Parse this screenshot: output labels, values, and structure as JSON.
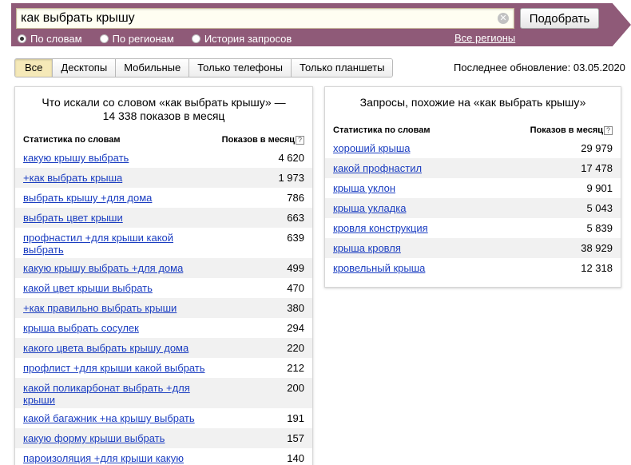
{
  "search": {
    "query": "как выбрать крышу",
    "button_label": "Подобрать",
    "clear_icon": "✕"
  },
  "modes": [
    {
      "label": "По словам",
      "checked": true
    },
    {
      "label": "По регионам",
      "checked": false
    },
    {
      "label": "История запросов",
      "checked": false
    }
  ],
  "regions_link": "Все регионы",
  "tabs": [
    {
      "label": "Все",
      "active": true
    },
    {
      "label": "Десктопы",
      "active": false
    },
    {
      "label": "Мобильные",
      "active": false
    },
    {
      "label": "Только телефоны",
      "active": false
    },
    {
      "label": "Только планшеты",
      "active": false
    }
  ],
  "last_update": "Последнее обновление: 03.05.2020",
  "left_panel": {
    "title": "Что искали со словом «как выбрать крышу» — 14 338 показов в месяц",
    "col_stat": "Статистика по словам",
    "col_shows": "Показов в месяц",
    "help_icon": "?",
    "rows": [
      {
        "phrase": "какую крышу выбрать",
        "count": "4 620"
      },
      {
        "phrase": "+как выбрать крыша",
        "count": "1 973"
      },
      {
        "phrase": "выбрать крышу +для дома",
        "count": "786"
      },
      {
        "phrase": "выбрать цвет крыши",
        "count": "663"
      },
      {
        "phrase": "профнастил +для крыши какой выбрать",
        "count": "639"
      },
      {
        "phrase": "какую крышу выбрать +для дома",
        "count": "499"
      },
      {
        "phrase": "какой цвет крыши выбрать",
        "count": "470"
      },
      {
        "phrase": "+как правильно выбрать крыши",
        "count": "380"
      },
      {
        "phrase": "крыша выбрать сосулек",
        "count": "294"
      },
      {
        "phrase": "какого цвета выбрать крышу дома",
        "count": "220"
      },
      {
        "phrase": "профлист +для крыши какой выбрать",
        "count": "212"
      },
      {
        "phrase": "какой поликарбонат выбрать +для крыши",
        "count": "200"
      },
      {
        "phrase": "какой багажник +на крышу выбрать",
        "count": "191"
      },
      {
        "phrase": "какую форму крыши выбрать",
        "count": "157"
      },
      {
        "phrase": "пароизоляция +для крыши какую выбрать",
        "count": "140"
      }
    ]
  },
  "right_panel": {
    "title": "Запросы, похожие на «как выбрать крышу»",
    "col_stat": "Статистика по словам",
    "col_shows": "Показов в месяц",
    "help_icon": "?",
    "rows": [
      {
        "phrase": "хороший крыша",
        "count": "29 979"
      },
      {
        "phrase": "какой профнастил",
        "count": "17 478"
      },
      {
        "phrase": "крыша уклон",
        "count": "9 901"
      },
      {
        "phrase": "крыша укладка",
        "count": "5 043"
      },
      {
        "phrase": "кровля конструкция",
        "count": "5 839"
      },
      {
        "phrase": "крыша кровля",
        "count": "38 929"
      },
      {
        "phrase": "кровельный крыша",
        "count": "12 318"
      }
    ]
  }
}
